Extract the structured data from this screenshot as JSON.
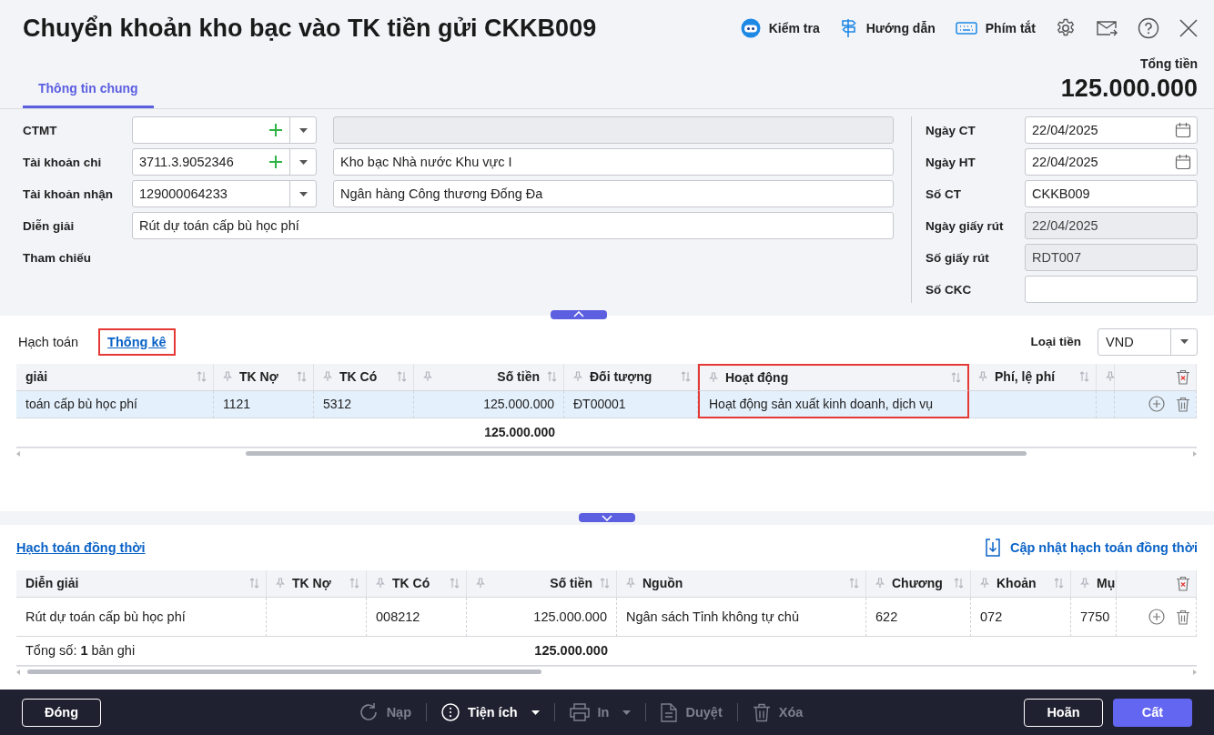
{
  "window": {
    "title": "Chuyển khoản kho bạc vào TK tiền gửi CKKB009"
  },
  "toolbar": [
    {
      "kind": "check",
      "label": "Kiểm tra"
    },
    {
      "kind": "guide",
      "label": "Hướng dẫn"
    },
    {
      "kind": "shortcut",
      "label": "Phím tắt"
    }
  ],
  "tabs": [
    {
      "label": "Thông tin chung",
      "selected": true
    }
  ],
  "total": {
    "label": "Tổng tiền",
    "value": "125.000.000"
  },
  "general": {
    "left": [
      {
        "label": "CTMT",
        "kind": "combo",
        "addable": true,
        "detail": {
          "disabled": true
        }
      },
      {
        "label": "Tài khoản chi",
        "kind": "combo",
        "value": "3711.3.9052346",
        "addable": true,
        "detail": {
          "value": "Kho bạc Nhà nước Khu vực I",
          "disabled": false
        }
      },
      {
        "label": "Tài khoản nhận",
        "kind": "combo",
        "value": "129000064233",
        "addable": false,
        "detail": {
          "value": "Ngân hàng Công thương Đống Đa",
          "disabled": false
        }
      },
      {
        "label": "Diễn giải",
        "kind": "text",
        "value": "Rút dự toán cấp bù học phí"
      },
      {
        "label": "Tham chiếu",
        "kind": "label"
      }
    ],
    "right": [
      {
        "label": "Ngày CT",
        "kind": "date",
        "value": "22/04/2025",
        "disabled": false
      },
      {
        "label": "Ngày HT",
        "kind": "date",
        "value": "22/04/2025",
        "disabled": false
      },
      {
        "label": "Số CT",
        "kind": "text",
        "value": "CKKB009",
        "disabled": false
      },
      {
        "label": "Ngày giấy rút",
        "kind": "text",
        "value": "22/04/2025",
        "disabled": true
      },
      {
        "label": "Số giấy rút",
        "kind": "text",
        "value": "RDT007",
        "disabled": true
      },
      {
        "label": "Số CKC",
        "kind": "text",
        "disabled": false
      }
    ]
  },
  "detail": {
    "tabs": [
      {
        "label": "Hạch toán",
        "selected": false,
        "highlighted": false
      },
      {
        "label": "Thống kê",
        "selected": true,
        "highlighted": true
      }
    ],
    "currency": {
      "label": "Loại tiền",
      "value": "VND"
    },
    "table": {
      "columns": [
        {
          "label": "giải",
          "highlighted": false
        },
        {
          "label": "TK Nợ",
          "highlighted": false
        },
        {
          "label": "TK Có",
          "highlighted": false
        },
        {
          "label": "Số tiền",
          "highlighted": false,
          "total": "125.000.000"
        },
        {
          "label": "Đối tượng",
          "highlighted": false
        },
        {
          "label": "Hoạt động",
          "highlighted": true
        },
        {
          "label": "Phí, lệ phí",
          "highlighted": false
        },
        {
          "highlighted": false
        }
      ],
      "rows": [
        {
          "selected": true,
          "cells": [
            "toán cấp bù học phí",
            "1121",
            "5312",
            "125.000.000",
            "ĐT00001",
            "Hoạt động sản xuất kinh doanh, dịch vụ",
            ""
          ]
        }
      ]
    }
  },
  "concurrent": {
    "title": "Hạch toán đồng thời",
    "action": "Cập nhật hạch toán đồng thời",
    "table": {
      "columns": [
        {
          "label": "Diễn giải",
          "highlighted": false
        },
        {
          "label": "TK Nợ",
          "highlighted": false
        },
        {
          "label": "TK Có",
          "highlighted": false
        },
        {
          "label": "Số tiền",
          "highlighted": false,
          "total": "125.000.000"
        },
        {
          "label": "Nguồn",
          "highlighted": false
        },
        {
          "label": "Chương",
          "highlighted": false
        },
        {
          "label": "Khoản",
          "highlighted": false
        },
        {
          "label": "Mụ",
          "highlighted": false
        }
      ],
      "rows": [
        {
          "selected": false,
          "cells": [
            "Rút dự toán cấp bù học phí",
            "",
            "008212",
            "125.000.000",
            "Ngân sách Tỉnh không tự chủ",
            "622",
            "072",
            "7750"
          ]
        }
      ],
      "footer": "Tổng số: **1** bản ghi"
    }
  },
  "actions": {
    "left": [
      {
        "label": "Đóng",
        "kind": "outline"
      }
    ],
    "center": [
      {
        "label": "Nạp",
        "kind": "reload",
        "disabled": true,
        "dropdown": false
      },
      {
        "label": "Tiện ích",
        "kind": "utilities",
        "disabled": false,
        "dropdown": true
      },
      {
        "label": "In",
        "kind": "print",
        "disabled": true,
        "dropdown": true
      },
      {
        "label": "Duyệt",
        "kind": "approve",
        "disabled": true,
        "dropdown": false
      },
      {
        "label": "Xóa",
        "kind": "delete",
        "disabled": true,
        "dropdown": false
      }
    ],
    "right": [
      {
        "label": "Hoãn",
        "kind": "outline"
      },
      {
        "label": "Cất",
        "kind": "primary"
      }
    ]
  }
}
